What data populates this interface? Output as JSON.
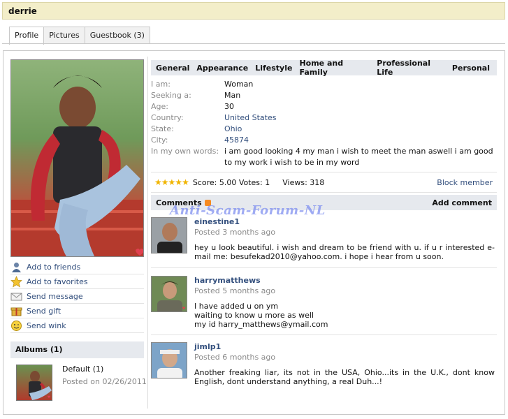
{
  "page": {
    "title": "derrie"
  },
  "tabs": [
    {
      "label": "Profile"
    },
    {
      "label": "Pictures"
    },
    {
      "label": "Guestbook (3)"
    }
  ],
  "actions": [
    {
      "label": "Add to friends",
      "icon": "user-icon"
    },
    {
      "label": "Add to favorites",
      "icon": "star-icon"
    },
    {
      "label": "Send message",
      "icon": "envelope-icon"
    },
    {
      "label": "Send gift",
      "icon": "gift-icon"
    },
    {
      "label": "Send wink",
      "icon": "smiley-icon"
    }
  ],
  "albums": {
    "heading": "Albums (1)",
    "items": [
      {
        "name": "Default (1)",
        "date": "Posted on 02/26/2011"
      }
    ]
  },
  "profile_nav": [
    "General",
    "Appearance",
    "Lifestyle",
    "Home and Family",
    "Professional Life",
    "Personal"
  ],
  "info": [
    {
      "label": "I am:",
      "value": "Woman"
    },
    {
      "label": "Seeking a:",
      "value": "Man"
    },
    {
      "label": "Age:",
      "value": "30"
    },
    {
      "label": "Country:",
      "value": "United States"
    },
    {
      "label": "State:",
      "value": "Ohio"
    },
    {
      "label": "City:",
      "value": "45874"
    },
    {
      "label": "In my own words:",
      "value": "i am good looking 4 my man i wish to meet the man aswell i am good to my work i wish to be in my word"
    }
  ],
  "rating": {
    "stars": 5,
    "score_text": "Score: 5.00 Votes: 1",
    "views_text": "Views: 318",
    "block_label": "Block member"
  },
  "comments": {
    "heading": "Comments",
    "add_label": "Add comment",
    "watermark": "Anti-Scam-Forum-NL",
    "items": [
      {
        "author": "einestine1",
        "when": "Posted 3 months ago",
        "text": "hey u look beautiful. i wish and dream to be friend with u. if u r interested e-mail me: besufekad2010@yahoo.com. i hope i hear from u soon."
      },
      {
        "author": "harrymatthews",
        "when": "Posted 5 months ago",
        "text": "I have added u on ym\nwaiting to know u more as well\nmy id harry_matthews@ymail.com"
      },
      {
        "author": "jimlp1",
        "when": "Posted 6 months ago",
        "text": "Another freaking liar, its not in the USA, Ohio...its in the U.K., dont know English, dont understand anything, a real Duh...!"
      }
    ]
  },
  "colors": {
    "link": "#334f7d",
    "header_bg": "#f3eec9",
    "section_bg": "#e6e9ee",
    "star": "#f0b400"
  }
}
